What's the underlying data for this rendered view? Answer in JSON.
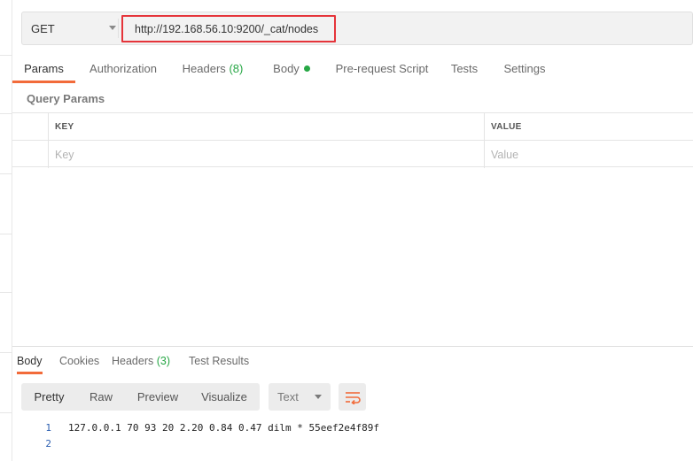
{
  "request": {
    "method": "GET",
    "url": "http://192.168.56.10:9200/_cat/nodes"
  },
  "request_tabs": [
    {
      "label": "Params",
      "active": true
    },
    {
      "label": "Authorization"
    },
    {
      "label": "Headers",
      "count": "(8)"
    },
    {
      "label": "Body",
      "indicator": "green-dot"
    },
    {
      "label": "Pre-request Script"
    },
    {
      "label": "Tests"
    },
    {
      "label": "Settings"
    }
  ],
  "query_params": {
    "title": "Query Params",
    "headers": {
      "key": "KEY",
      "value": "VALUE"
    },
    "placeholders": {
      "key": "Key",
      "value": "Value"
    }
  },
  "response_tabs": [
    {
      "label": "Body",
      "active": true
    },
    {
      "label": "Cookies"
    },
    {
      "label": "Headers",
      "count": "(3)"
    },
    {
      "label": "Test Results"
    }
  ],
  "view_modes": [
    "Pretty",
    "Raw",
    "Preview",
    "Visualize"
  ],
  "active_view_mode": "Pretty",
  "format_select": "Text",
  "response_body": [
    {
      "line": "1",
      "text": "127.0.0.1 70 93 20 2.20 0.84 0.47 dilm * 55eef2e4f89f"
    },
    {
      "line": "2",
      "text": ""
    }
  ],
  "colors": {
    "accent": "#f26b3a",
    "highlight_border": "#e5343a",
    "count_green": "#27a745",
    "line_number": "#2a5db0"
  },
  "icons": {
    "method_dropdown": "chevron-down-icon",
    "wrap": "wrap-lines-icon",
    "format_dropdown": "chevron-down-icon"
  }
}
